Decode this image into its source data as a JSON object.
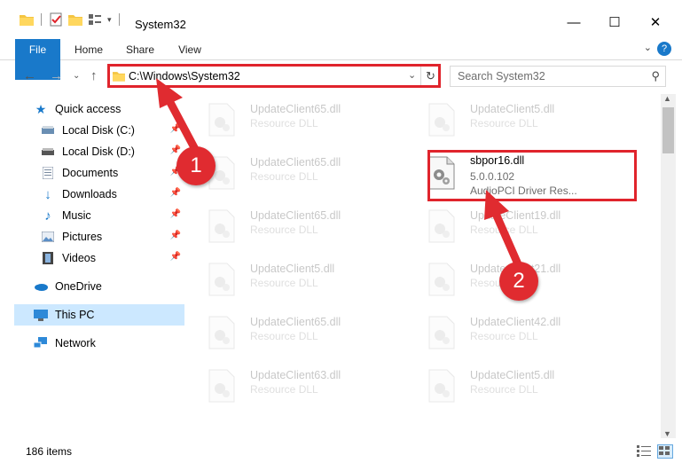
{
  "window": {
    "title": "System32",
    "minimize": "—",
    "maximize": "☐",
    "close": "✕"
  },
  "ribbon": {
    "tabs": [
      "File",
      "Home",
      "Share",
      "View"
    ]
  },
  "address": {
    "path": "C:\\Windows\\System32",
    "search_placeholder": "Search System32"
  },
  "nav": {
    "items": [
      {
        "label": "Quick access",
        "icon": "star-icon"
      },
      {
        "label": "Local Disk (C:)",
        "icon": "drive-icon"
      },
      {
        "label": "Local Disk (D:)",
        "icon": "drive-icon"
      },
      {
        "label": "Documents",
        "icon": "documents-icon"
      },
      {
        "label": "Downloads",
        "icon": "download-icon"
      },
      {
        "label": "Music",
        "icon": "music-icon"
      },
      {
        "label": "Pictures",
        "icon": "pictures-icon"
      },
      {
        "label": "Videos",
        "icon": "videos-icon"
      },
      {
        "label": "OneDrive",
        "icon": "cloud-icon"
      },
      {
        "label": "This PC",
        "icon": "computer-icon"
      },
      {
        "label": "Network",
        "icon": "network-icon"
      }
    ]
  },
  "files": {
    "left": [
      {
        "name": "UpdateClient65.dll",
        "type": "Resource DLL"
      },
      {
        "name": "UpdateClient65.dll",
        "type": "Resource DLL"
      },
      {
        "name": "UpdateClient65.dll",
        "type": "Resource DLL"
      },
      {
        "name": "UpdateClient5.dll",
        "type": "Resource DLL"
      },
      {
        "name": "UpdateClient65.dll",
        "type": "Resource DLL"
      },
      {
        "name": "UpdateClient63.dll",
        "type": "Resource DLL"
      }
    ],
    "right": [
      {
        "name": "UpdateClient5.dll",
        "type": "Resource DLL"
      },
      {
        "name": "UpdateClient19.dll",
        "type": "Resource DLL"
      },
      {
        "name": "UpdateClient21.dll",
        "type": "Resource DLL"
      },
      {
        "name": "UpdateClient42.dll",
        "type": "Resource DLL"
      },
      {
        "name": "UpdateClient5.dll",
        "type": "Resource DLL"
      }
    ],
    "highlight": {
      "name": "sbpor16.dll",
      "version": "5.0.0.102",
      "description": "AudioPCI Driver Res..."
    }
  },
  "status": {
    "count": "186 items"
  },
  "markers": [
    "1",
    "2"
  ],
  "colors": {
    "accent": "#1979ca",
    "marker": "#e02b30",
    "selection": "#cce8ff"
  }
}
